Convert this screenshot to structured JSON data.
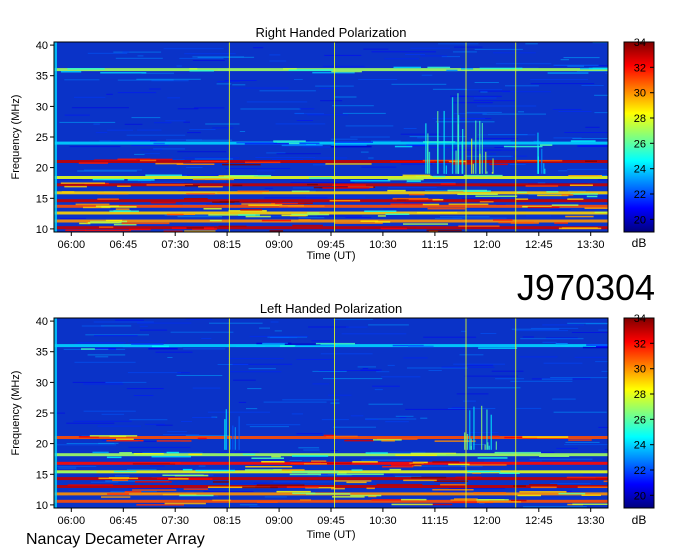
{
  "figure": {
    "observation_id": "J970304",
    "footer_label": "Nancay Decameter Array"
  },
  "chart_data": [
    {
      "type": "heatmap",
      "title": "Right Handed Polarization",
      "xlabel": "Time (UT)",
      "ylabel": "Frequency (MHz)",
      "x_ticks": [
        "06:00",
        "06:45",
        "07:30",
        "08:15",
        "09:00",
        "09:45",
        "10:30",
        "11:15",
        "12:00",
        "12:45",
        "13:30"
      ],
      "x_tick_minutes": [
        360,
        405,
        450,
        495,
        540,
        585,
        630,
        675,
        720,
        765,
        810
      ],
      "xlim_minutes": [
        345,
        825
      ],
      "y_ticks": [
        10,
        15,
        20,
        25,
        30,
        35,
        40
      ],
      "ylim": [
        9.5,
        40.5
      ],
      "colorbar": {
        "label": "dB",
        "ticks": [
          20,
          22,
          24,
          26,
          28,
          30,
          32,
          34
        ],
        "range": [
          19,
          34
        ]
      },
      "bands": [
        {
          "freq": 10.2,
          "db": 33
        },
        {
          "freq": 11.3,
          "db": 30
        },
        {
          "freq": 12.6,
          "db": 29
        },
        {
          "freq": 13.7,
          "db": 31
        },
        {
          "freq": 14.6,
          "db": 33
        },
        {
          "freq": 15.9,
          "db": 29
        },
        {
          "freq": 17.2,
          "db": 33
        },
        {
          "freq": 18.4,
          "db": 28
        },
        {
          "freq": 21.0,
          "db": 33
        },
        {
          "freq": 24.0,
          "db": 24
        },
        {
          "freq": 36.0,
          "db": 27
        }
      ],
      "bursts": [
        {
          "start": 665,
          "end": 700,
          "fmin": 19,
          "fmax": 33,
          "db": 26
        },
        {
          "start": 706,
          "end": 728,
          "fmin": 19,
          "fmax": 29,
          "db": 27
        },
        {
          "start": 762,
          "end": 770,
          "fmin": 19,
          "fmax": 26,
          "db": 25
        }
      ],
      "vertical_lines": [
        497,
        588,
        702,
        745
      ]
    },
    {
      "type": "heatmap",
      "title": "Left Handed Polarization",
      "xlabel": "Time (UT)",
      "ylabel": "Frequency (MHz)",
      "x_ticks": [
        "06:00",
        "06:45",
        "07:30",
        "08:15",
        "09:00",
        "09:45",
        "10:30",
        "11:15",
        "12:00",
        "12:45",
        "13:30"
      ],
      "x_tick_minutes": [
        360,
        405,
        450,
        495,
        540,
        585,
        630,
        675,
        720,
        765,
        810
      ],
      "xlim_minutes": [
        345,
        825
      ],
      "y_ticks": [
        10,
        15,
        20,
        25,
        30,
        35,
        40
      ],
      "ylim": [
        9.5,
        40.5
      ],
      "colorbar": {
        "label": "dB",
        "ticks": [
          20,
          22,
          24,
          26,
          28,
          30,
          32,
          34
        ],
        "range": [
          19,
          34
        ]
      },
      "bands": [
        {
          "freq": 10.6,
          "db": 31
        },
        {
          "freq": 11.8,
          "db": 30
        },
        {
          "freq": 13.0,
          "db": 33
        },
        {
          "freq": 14.3,
          "db": 33
        },
        {
          "freq": 15.4,
          "db": 28
        },
        {
          "freq": 16.8,
          "db": 32
        },
        {
          "freq": 18.2,
          "db": 27
        },
        {
          "freq": 21.0,
          "db": 31
        },
        {
          "freq": 36.0,
          "db": 24
        }
      ],
      "bursts": [
        {
          "start": 700,
          "end": 728,
          "fmin": 19,
          "fmax": 28,
          "db": 26
        },
        {
          "start": 490,
          "end": 505,
          "fmin": 19,
          "fmax": 27,
          "db": 24
        }
      ],
      "vertical_lines": [
        497,
        588,
        702,
        745
      ]
    }
  ]
}
